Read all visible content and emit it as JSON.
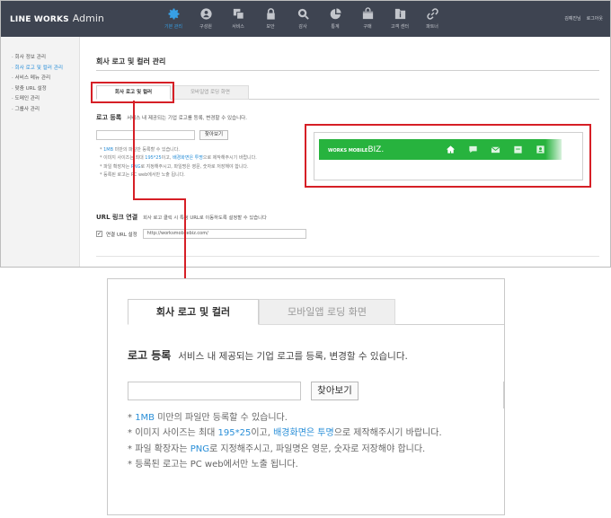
{
  "app": {
    "brand": "LINE WORKS",
    "title": "Admin"
  },
  "nav": [
    {
      "label": "기본 관리",
      "icon": "gear-icon",
      "active": true
    },
    {
      "label": "구성원",
      "icon": "person-icon",
      "active": false
    },
    {
      "label": "서비스",
      "icon": "layers-icon",
      "active": false
    },
    {
      "label": "보안",
      "icon": "lock-icon",
      "active": false
    },
    {
      "label": "감사",
      "icon": "audit-search-icon",
      "active": false
    },
    {
      "label": "통계",
      "icon": "pie-chart-icon",
      "active": false
    },
    {
      "label": "구매",
      "icon": "shopping-bag-icon",
      "active": false
    },
    {
      "label": "고객 센터",
      "icon": "info-doc-icon",
      "active": false
    },
    {
      "label": "파트너",
      "icon": "link-icon",
      "active": false
    }
  ],
  "user": {
    "name": "김예진님",
    "logout": "로그아웃"
  },
  "sidebar": {
    "items": [
      {
        "label": "· 회사 정보 관리",
        "active": false
      },
      {
        "label": "· 회사 로고 및 컬러 관리",
        "active": true
      },
      {
        "label": "· 서비스 메뉴 관리",
        "active": false
      },
      {
        "label": "· 맞춤 URL 설정",
        "active": false
      },
      {
        "label": "· 도메인 관리",
        "active": false
      },
      {
        "label": "· 그룹사 관리",
        "active": false
      }
    ]
  },
  "page": {
    "title": "회사 로고 및 컬러 관리"
  },
  "tabs": {
    "active": "회사 로고 및 컬러",
    "inactive": "모바일앱 로딩 화면"
  },
  "logo_section": {
    "heading": "로고 등록",
    "description": "서비스 내 제공되는 기업 로고를 등록, 변경할 수 있습니다.",
    "browse_label": "찾아보기",
    "file_value": ""
  },
  "notes": {
    "n1_hl": "1MB",
    "n1_rest": " 미만의 파일만 등록할 수 있습니다.",
    "n2_a": "이미지 사이즈는 최대 ",
    "n2_hl1": "195*25",
    "n2_b": "이고, ",
    "n2_hl2": "배경화면은 투명",
    "n2_c": "으로 제작해주시기 바랍니다.",
    "n3_a": "파일 확장자는 ",
    "n3_hl": "PNG",
    "n3_b": "로 지정해주시고, 파일명은 영문, 숫자로 저장해야 합니다.",
    "n4": "등록된 로고는 PC web에서만 노출 됩니다."
  },
  "preview": {
    "logo_small": "WORKS MOBILE",
    "logo_main": "BIZ.",
    "bar_color": "#27b33e",
    "icons": [
      "home-icon",
      "chat-icon",
      "mail-icon",
      "calendar-icon",
      "contact-icon"
    ]
  },
  "url_section": {
    "heading": "URL 링크 연결",
    "description": "회사 로고 클릭 시 특정 URL로 이동하도록 설정할 수 있습니다",
    "checkbox_label": "연결 URL 설정",
    "url_value": "http://worksmobilebiz.com/"
  },
  "colors": {
    "accent": "#2a8fd8",
    "highlight_box": "#d61f26",
    "header_bg": "#3e4451",
    "active_nav": "#37a0e6"
  }
}
